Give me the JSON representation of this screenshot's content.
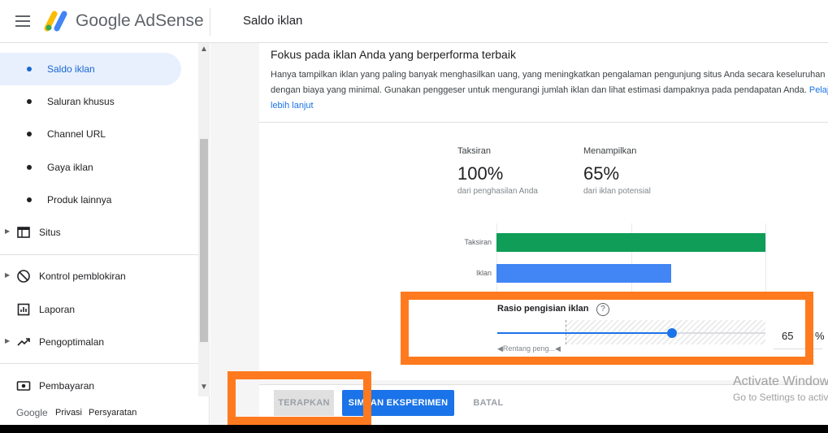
{
  "header": {
    "logo_text": "Google AdSense",
    "page_title": "Saldo iklan"
  },
  "sidebar": {
    "sub_items": [
      {
        "label": "Saldo iklan",
        "active": true
      },
      {
        "label": "Saluran khusus"
      },
      {
        "label": "Channel URL"
      },
      {
        "label": "Gaya iklan"
      },
      {
        "label": "Produk lainnya"
      }
    ],
    "items": [
      {
        "label": "Situs",
        "icon": "web-icon"
      },
      {
        "label": "Kontrol pemblokiran",
        "icon": "block-icon"
      },
      {
        "label": "Laporan",
        "icon": "report-icon"
      },
      {
        "label": "Pengoptimalan",
        "icon": "trending-up-icon"
      },
      {
        "label": "Pembayaran",
        "icon": "payment-icon"
      }
    ],
    "footer": {
      "brand": "Google",
      "privacy": "Privasi",
      "terms": "Persyaratan"
    }
  },
  "card": {
    "title": "Fokus pada iklan Anda yang berperforma terbaik",
    "description": "Hanya tampilkan iklan yang paling banyak menghasilkan uang, yang meningkatkan pengalaman pengunjung situs Anda secara keseluruhan dengan biaya yang minimal. Gunakan penggeser untuk mengurangi jumlah iklan dan lihat estimasi dampaknya pada pendapatan Anda.",
    "learn_more": "Pelajari lebih lanjut"
  },
  "stats": {
    "estimate": {
      "caption": "Taksiran",
      "value": "100%",
      "sub": "dari penghasilan Anda"
    },
    "showing": {
      "caption": "Menampilkan",
      "value": "65%",
      "sub": "dari iklan potensial"
    }
  },
  "chart_data": {
    "type": "bar",
    "categories": [
      "Taksiran",
      "Iklan"
    ],
    "values": [
      100,
      65
    ],
    "colors": [
      "#0f9d58",
      "#4285f4"
    ]
  },
  "slider": {
    "title": "Rasio pengisian iklan",
    "range_label": "Rentang peng...",
    "value": "65",
    "unit": "%",
    "fraction": 0.65,
    "recommended_start": 0.25
  },
  "actions": {
    "apply": "TERAPKAN",
    "save": "SIMPAN EKSPERIMEN",
    "cancel": "BATAL"
  },
  "watermark": {
    "line1": "Activate Windows",
    "line2": "Go to Settings to activate Windows."
  },
  "colors": {
    "accent": "#1a73e8",
    "highlight": "#ff7a1f",
    "active_bg": "#e8f0fe"
  }
}
